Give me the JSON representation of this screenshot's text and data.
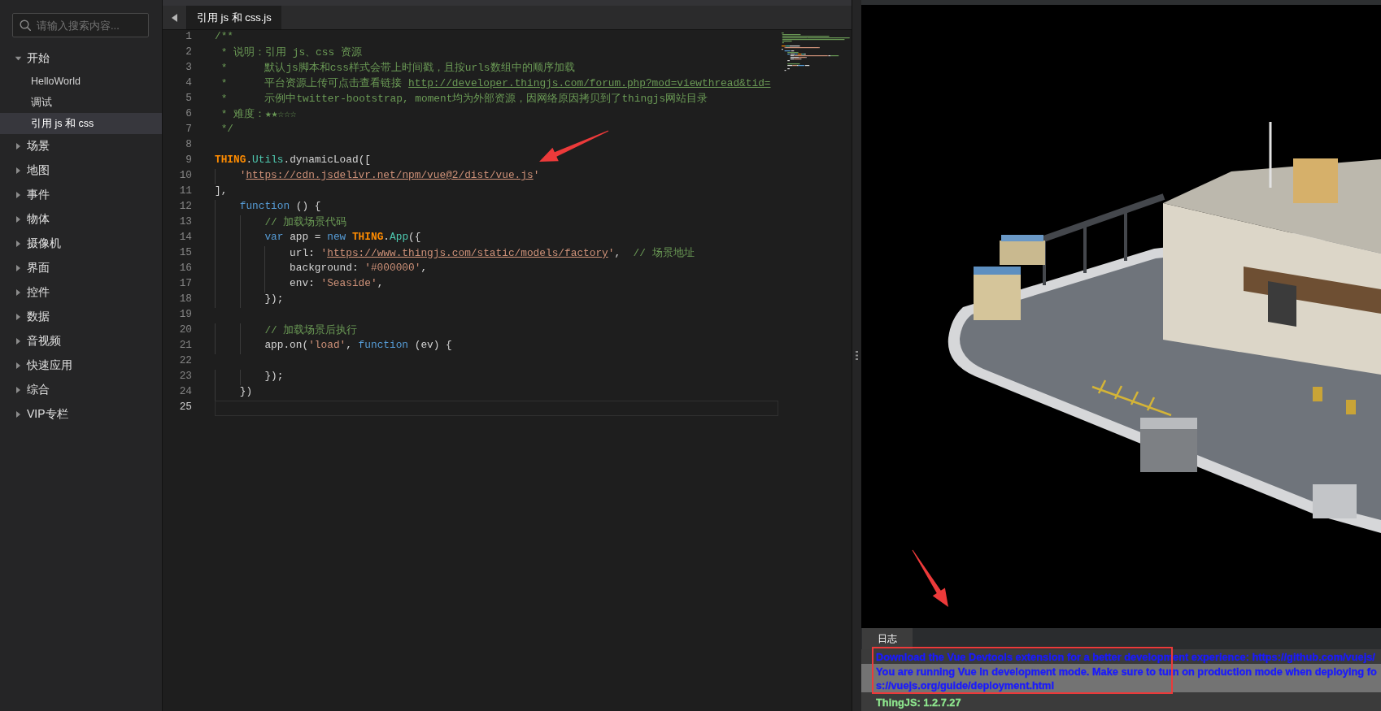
{
  "sidebar": {
    "search": {
      "placeholder": "请输入搜索内容..."
    },
    "tree": [
      {
        "label": "开始",
        "expanded": true,
        "selected": false,
        "children": [
          {
            "label": "HelloWorld",
            "selected": false
          },
          {
            "label": "调试",
            "selected": false
          },
          {
            "label": "引用 js 和 css",
            "selected": true
          }
        ]
      },
      {
        "label": "场景",
        "expanded": false,
        "selected": false
      },
      {
        "label": "地图",
        "expanded": false,
        "selected": false
      },
      {
        "label": "事件",
        "expanded": false,
        "selected": false
      },
      {
        "label": "物体",
        "expanded": false,
        "selected": false
      },
      {
        "label": "摄像机",
        "expanded": false,
        "selected": false
      },
      {
        "label": "界面",
        "expanded": false,
        "selected": false
      },
      {
        "label": "控件",
        "expanded": false,
        "selected": false
      },
      {
        "label": "数据",
        "expanded": false,
        "selected": false
      },
      {
        "label": "音视频",
        "expanded": false,
        "selected": false
      },
      {
        "label": "快速应用",
        "expanded": false,
        "selected": false
      },
      {
        "label": "综合",
        "expanded": false,
        "selected": false
      },
      {
        "label": "VIP专栏",
        "expanded": false,
        "selected": false
      }
    ]
  },
  "editor": {
    "tabs": [
      {
        "label": "引用 js 和 css.js",
        "selected": true
      }
    ],
    "lines": [
      {
        "number": "1",
        "current": false,
        "tokens": [
          {
            "kind": "comment",
            "text": "/**"
          }
        ]
      },
      {
        "number": "2",
        "current": false,
        "tokens": [
          {
            "kind": "comment",
            "text": " * 说明：引用 js、css 资源"
          }
        ]
      },
      {
        "number": "3",
        "current": false,
        "tokens": [
          {
            "kind": "comment",
            "text": " *      默认js脚本和css样式会带上时间戳，且按urls数组中的顺序加载"
          }
        ]
      },
      {
        "number": "4",
        "current": false,
        "tokens": [
          {
            "kind": "comment",
            "text": " *      平台资源上传可点击查看链接 "
          },
          {
            "kind": "comment_link",
            "text": "http://developer.thingjs.com/forum.php?mod=viewthread&tid="
          }
        ]
      },
      {
        "number": "5",
        "current": false,
        "tokens": [
          {
            "kind": "comment",
            "text": " *      示例中twitter-bootstrap, moment均为外部资源，因网络原因拷贝到了thingjs网站目录"
          }
        ]
      },
      {
        "number": "6",
        "current": false,
        "tokens": [
          {
            "kind": "comment",
            "text": " * 难度：★★☆☆☆"
          }
        ]
      },
      {
        "number": "7",
        "current": false,
        "tokens": [
          {
            "kind": "comment",
            "text": " */"
          }
        ]
      },
      {
        "number": "8",
        "current": false
      },
      {
        "number": "9",
        "current": false,
        "tokens": [
          {
            "kind": "object",
            "text": "THING"
          },
          {
            "kind": "plain",
            "text": "."
          },
          {
            "kind": "type",
            "text": "Utils"
          },
          {
            "kind": "plain",
            "text": ".dynamicLoad(["
          }
        ]
      },
      {
        "number": "10",
        "current": false,
        "tokens": [
          {
            "kind": "string",
            "text": "    '"
          },
          {
            "kind": "string_link",
            "text": "https://cdn.jsdelivr.net/npm/vue@2/dist/vue.js"
          },
          {
            "kind": "string",
            "text": "'"
          }
        ]
      },
      {
        "number": "11",
        "current": false,
        "tokens": [
          {
            "kind": "plain",
            "text": "],"
          }
        ]
      },
      {
        "number": "12",
        "current": false,
        "tokens": [
          {
            "kind": "keyword",
            "text": "    function"
          },
          {
            "kind": "plain",
            "text": " () {"
          }
        ]
      },
      {
        "number": "13",
        "current": false,
        "tokens": [
          {
            "kind": "comment",
            "text": "        // 加载场景代码"
          }
        ]
      },
      {
        "number": "14",
        "current": false,
        "tokens": [
          {
            "kind": "keyword",
            "text": "        var"
          },
          {
            "kind": "plain",
            "text": " app = "
          },
          {
            "kind": "keyword",
            "text": "new "
          },
          {
            "kind": "object",
            "text": "THING"
          },
          {
            "kind": "plain",
            "text": "."
          },
          {
            "kind": "type",
            "text": "App"
          },
          {
            "kind": "plain",
            "text": "({"
          }
        ]
      },
      {
        "number": "15",
        "current": false,
        "tokens": [
          {
            "kind": "plain",
            "text": "            url: "
          },
          {
            "kind": "string",
            "text": "'"
          },
          {
            "kind": "string_link",
            "text": "https://www.thingjs.com/static/models/factory"
          },
          {
            "kind": "string",
            "text": "'"
          },
          {
            "kind": "plain",
            "text": ",  "
          },
          {
            "kind": "comment",
            "text": "// 场景地址"
          }
        ]
      },
      {
        "number": "16",
        "current": false,
        "tokens": [
          {
            "kind": "plain",
            "text": "            background: "
          },
          {
            "kind": "string",
            "text": "'#000000'"
          },
          {
            "kind": "plain",
            "text": ","
          }
        ]
      },
      {
        "number": "17",
        "current": false,
        "tokens": [
          {
            "kind": "plain",
            "text": "            env: "
          },
          {
            "kind": "string",
            "text": "'Seaside'"
          },
          {
            "kind": "plain",
            "text": ","
          }
        ]
      },
      {
        "number": "18",
        "current": false,
        "tokens": [
          {
            "kind": "plain",
            "text": "        });"
          }
        ]
      },
      {
        "number": "19",
        "current": false
      },
      {
        "number": "20",
        "current": false,
        "tokens": [
          {
            "kind": "comment",
            "text": "        // 加载场景后执行"
          }
        ]
      },
      {
        "number": "21",
        "current": false,
        "tokens": [
          {
            "kind": "plain",
            "text": "        app.on("
          },
          {
            "kind": "string",
            "text": "'load'"
          },
          {
            "kind": "plain",
            "text": ", "
          },
          {
            "kind": "keyword",
            "text": "function"
          },
          {
            "kind": "plain",
            "text": " (ev) {"
          }
        ]
      },
      {
        "number": "22",
        "current": false
      },
      {
        "number": "23",
        "current": false,
        "tokens": [
          {
            "kind": "plain",
            "text": "        });"
          }
        ]
      },
      {
        "number": "24",
        "current": false,
        "tokens": [
          {
            "kind": "plain",
            "text": "    })"
          }
        ]
      },
      {
        "number": "25",
        "current": true
      }
    ]
  },
  "log": {
    "tabs": [
      {
        "label": "日志",
        "selected": true
      }
    ],
    "entries": [
      {
        "color": "#1a1aff",
        "lines": [
          "Download the Vue Devtools extension for a better development experience: https://github.com/vuejs/"
        ]
      },
      {
        "color": "#1a1aff",
        "lines": [
          "You are running Vue in development mode. Make sure to turn on production mode when deploying fo",
          "s://vuejs.org/guide/deployment.html"
        ]
      },
      {
        "color": "#8ee68e",
        "lines": [
          "ThingJS: 1.2.7.27"
        ]
      }
    ]
  }
}
